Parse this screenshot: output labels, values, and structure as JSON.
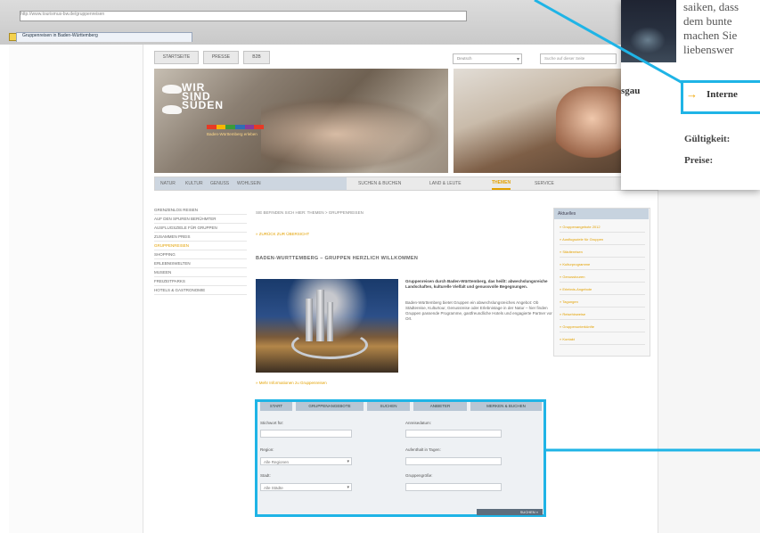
{
  "browser": {
    "address": "http://www.tourismus-bw.de/gruppenreisen",
    "tab_title": "Gruppenreisen in Baden-Württemberg"
  },
  "topnav": [
    "STARTSEITE",
    "PRESSE",
    "B2B"
  ],
  "language_select": "Deutsch",
  "search_placeholder": "Suche auf dieser Seite",
  "hero": {
    "lines": [
      "WIR",
      "SIND",
      "SÜDEN"
    ],
    "subline": "Baden-Württemberg erleben"
  },
  "colors": {
    "accent": "#e3a100",
    "highlight": "#1fb4e6",
    "navbar": "#cdd6e0"
  },
  "mainnav_left": [
    "NATUR",
    "KULTUR",
    "GENUSS",
    "WOHLSEIN"
  ],
  "mainnav_right": [
    "SUCHEN & BUCHEN",
    "LAND & LEUTE",
    "THEMEN",
    "SERVICE"
  ],
  "mainnav_active": "THEMEN",
  "leftmenu": [
    "GRENZENLOS REISEN",
    "AUF DEN SPUREN BERÜHMTER",
    "AUSFLUGSZIELE FÜR GRUPPEN",
    "ZUSAMMEN PREIS",
    "GRUPPENREISEN",
    "SHOPPING",
    "ERLEBNISWELTEN",
    "MUSEEN",
    "FREIZEITPARKS",
    "HOTELS & GASTRONOMIE"
  ],
  "leftmenu_selected": "GRUPPENREISEN",
  "content": {
    "breadcrumb": "SIE BEFINDEN SICH HIER: THEMEN > GRUPPENREISEN",
    "back": "» ZURÜCK ZUR ÜBERSICHT",
    "heading": "BADEN-WÜRTTEMBERG – GRUPPEN HERZLICH WILLKOMMEN",
    "intro_bold": "Gruppenreisen durch Baden-Württemberg, das heißt: abwechslungsreiche Landschaften, kulturelle Vielfalt und genussvolle Begegnungen.",
    "intro": "Baden-Württemberg bietet Gruppen ein abwechslungsreiches Angebot: Ob Städtereise, Kulturtour, Genussreise oder Erlebnistage in der Natur – hier finden Gruppen passende Programme, gastfreundliche Hotels und engagierte Partner vor Ort.",
    "more": "» Mehr Informationen zu Gruppenreisen"
  },
  "sidebar": {
    "title": "Aktuelles",
    "items": [
      "» Gruppenangebote 2012",
      "» Ausflugsziele für Gruppen",
      "» Städtereisen",
      "» Kulturprogramme",
      "» Genusstouren",
      "» Erlebnis-Angebote",
      "» Tagungen",
      "» Reisehinweise",
      "» Gruppenunterkünfte",
      "» Kontakt"
    ]
  },
  "panel": {
    "tabs": [
      "START",
      "GRUPPENANGEBOTE",
      "SUCHEN",
      "ANBIETER",
      "MERKEN & BUCHEN"
    ],
    "fields_left": [
      {
        "label": "Stichwort für:",
        "value": ""
      },
      {
        "label": "Region:",
        "value": "Alle Regionen"
      },
      {
        "label": "Stadt:",
        "value": "Alle Städte"
      }
    ],
    "fields_right": [
      {
        "label": "Anreisedatum:",
        "value": ""
      },
      {
        "label": "Aufenthalt in Tagen:",
        "value": ""
      },
      {
        "label": "Gruppengröße:",
        "value": ""
      }
    ],
    "button": "SUCHEN »"
  },
  "callout": {
    "lines": [
      "saiken, dass",
      "dem bunte",
      "machen Sie",
      "liebenswer"
    ],
    "left_word": "sgau",
    "link": "Interne",
    "meta1": "Gültigkeit:",
    "meta2": "Preise:"
  }
}
